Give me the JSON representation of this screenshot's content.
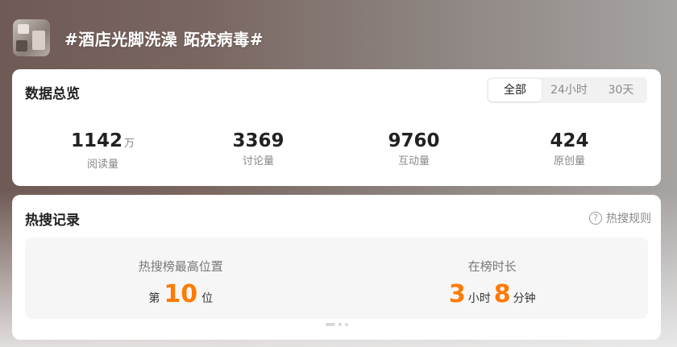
{
  "header": {
    "title": "#酒店光脚洗澡 跖疣病毒#"
  },
  "overview": {
    "title": "数据总览",
    "tabs": [
      "全部",
      "24小时",
      "30天"
    ],
    "stats": [
      {
        "value": "1142",
        "unit": "万",
        "label": "阅读量"
      },
      {
        "value": "3369",
        "unit": "",
        "label": "讨论量"
      },
      {
        "value": "9760",
        "unit": "",
        "label": "互动量"
      },
      {
        "value": "424",
        "unit": "",
        "label": "原创量"
      }
    ]
  },
  "hot_search": {
    "title": "热搜记录",
    "rules_label": "热搜规则",
    "rules_icon": "question-icon",
    "rank": {
      "label": "热搜榜最高位置",
      "prefix": "第",
      "value": "10",
      "suffix": "位"
    },
    "duration": {
      "label": "在榜时长",
      "hours": "3",
      "hours_unit": "小时",
      "minutes": "8",
      "minutes_unit": "分钟"
    }
  },
  "colors": {
    "accent": "#ff7a00"
  }
}
